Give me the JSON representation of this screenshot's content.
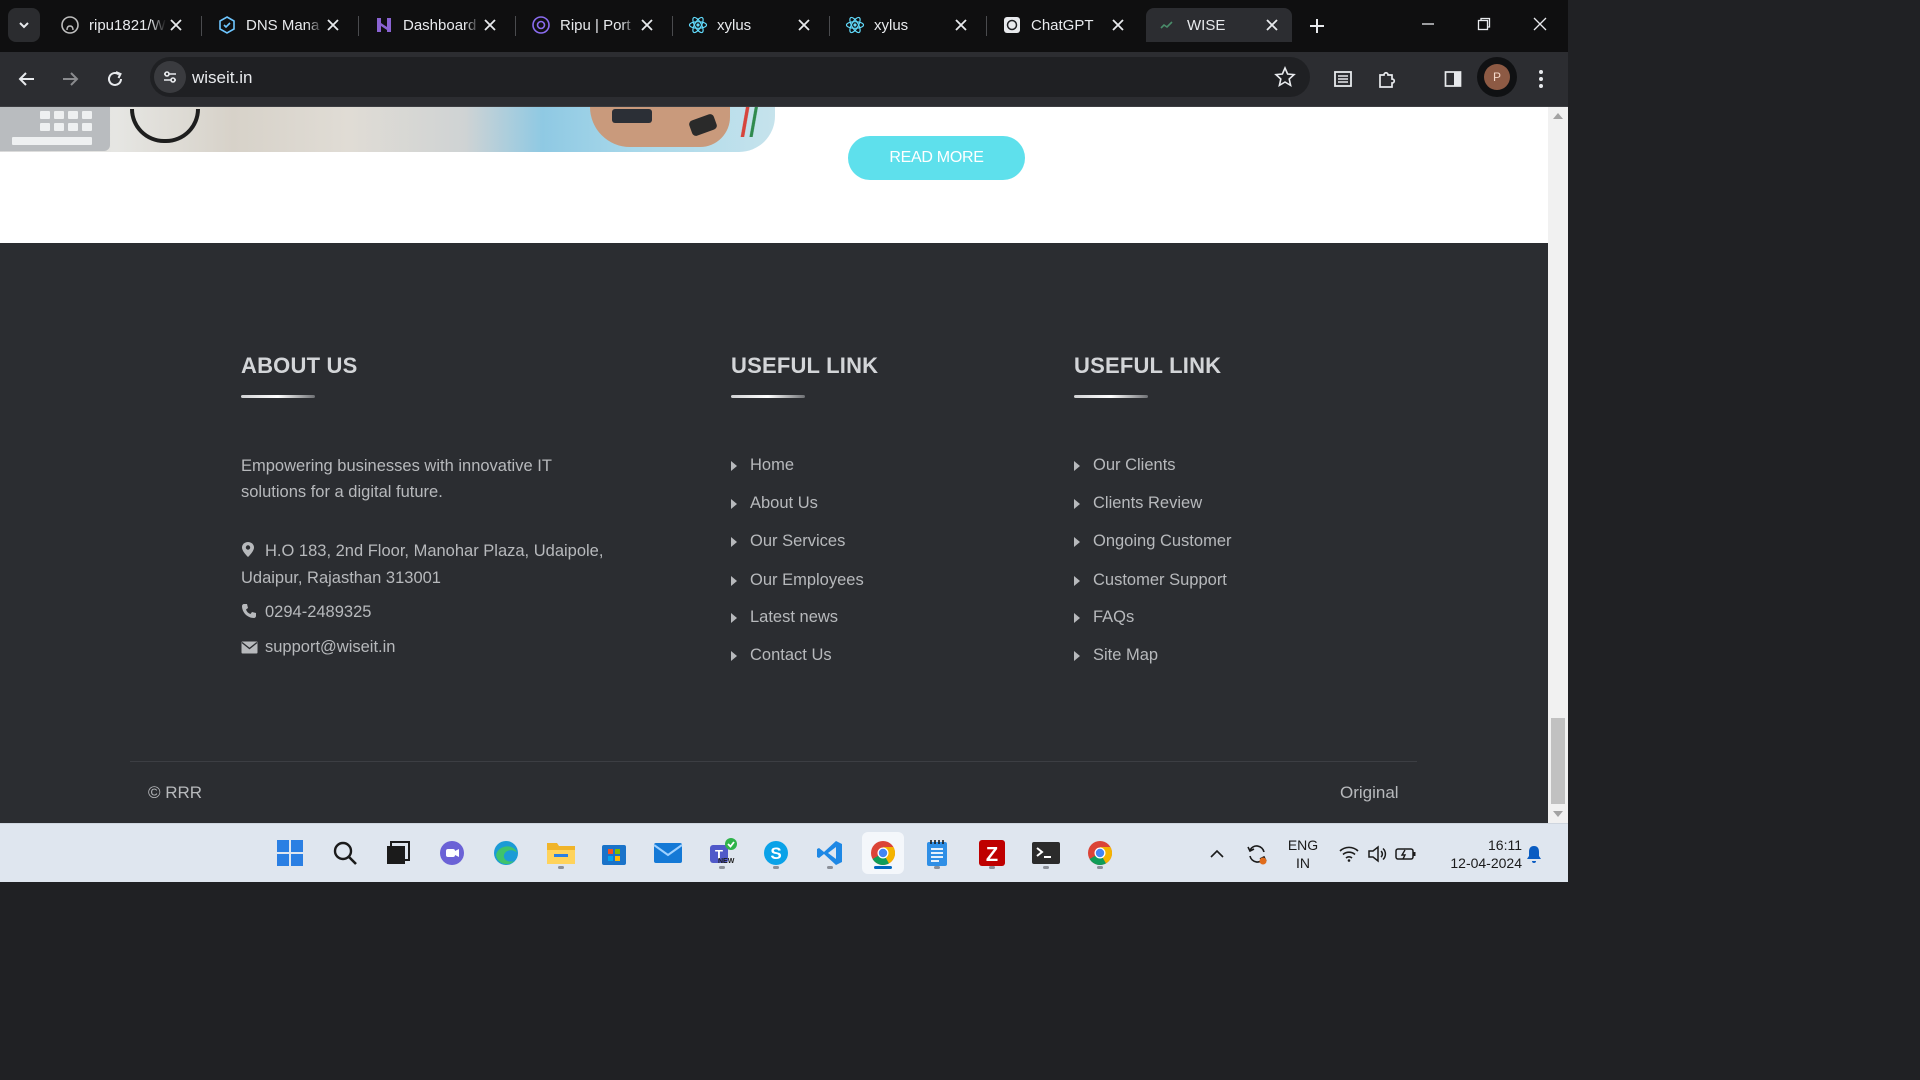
{
  "browser": {
    "tabs": [
      {
        "title": "ripu1821/W",
        "icon": "github-icon"
      },
      {
        "title": "DNS Mana",
        "icon": "dns-icon"
      },
      {
        "title": "Dashboard",
        "icon": "dashboard-icon"
      },
      {
        "title": "Ripu | Port",
        "icon": "portfolio-icon"
      },
      {
        "title": "xylus",
        "icon": "react-icon"
      },
      {
        "title": "xylus",
        "icon": "react-icon"
      },
      {
        "title": "ChatGPT",
        "icon": "chatgpt-icon"
      },
      {
        "title": "WISE",
        "icon": "wise-icon",
        "active": true
      }
    ],
    "url": "wiseit.in",
    "profile_initial": "P"
  },
  "page": {
    "read_more": "READ MORE",
    "footer": {
      "about_title": "ABOUT US",
      "about_text_line1": "Empowering businesses with innovative IT",
      "about_text_line2": "solutions for a digital future.",
      "address_line1": "H.O 183, 2nd Floor, Manohar Plaza, Udaipole,",
      "address_line2": "Udaipur, Rajasthan 313001",
      "phone": "0294-2489325",
      "email": "support@wiseit.in",
      "links1_title": "USEFUL LINK",
      "links1": [
        "Home",
        "About Us",
        "Our Services",
        "Our Employees",
        "Latest news",
        "Contact Us"
      ],
      "links2_title": "USEFUL LINK",
      "links2": [
        "Our Clients",
        "Clients Review",
        "Ongoing Customer",
        "Customer Support",
        "FAQs",
        "Site Map"
      ],
      "copyright": "© RRR",
      "original": "Original"
    }
  },
  "taskbar": {
    "apps": [
      "start-icon",
      "search-icon",
      "task-view-icon",
      "teams-chat-icon",
      "edge-icon",
      "file-explorer-icon",
      "microsoft-store-icon",
      "mail-icon",
      "teams-icon",
      "skype-icon",
      "vscode-icon",
      "chrome-icon",
      "notepad-icon",
      "filezilla-icon",
      "terminal-icon",
      "chrome-icon"
    ],
    "teams_badge": "NEW",
    "lang_line1": "ENG",
    "lang_line2": "IN",
    "time": "16:11",
    "date": "12-04-2024"
  },
  "colors": {
    "accent_button": "#5ee0ec",
    "footer_bg": "#2b2d31",
    "browser_chrome": "#2c2d31"
  }
}
